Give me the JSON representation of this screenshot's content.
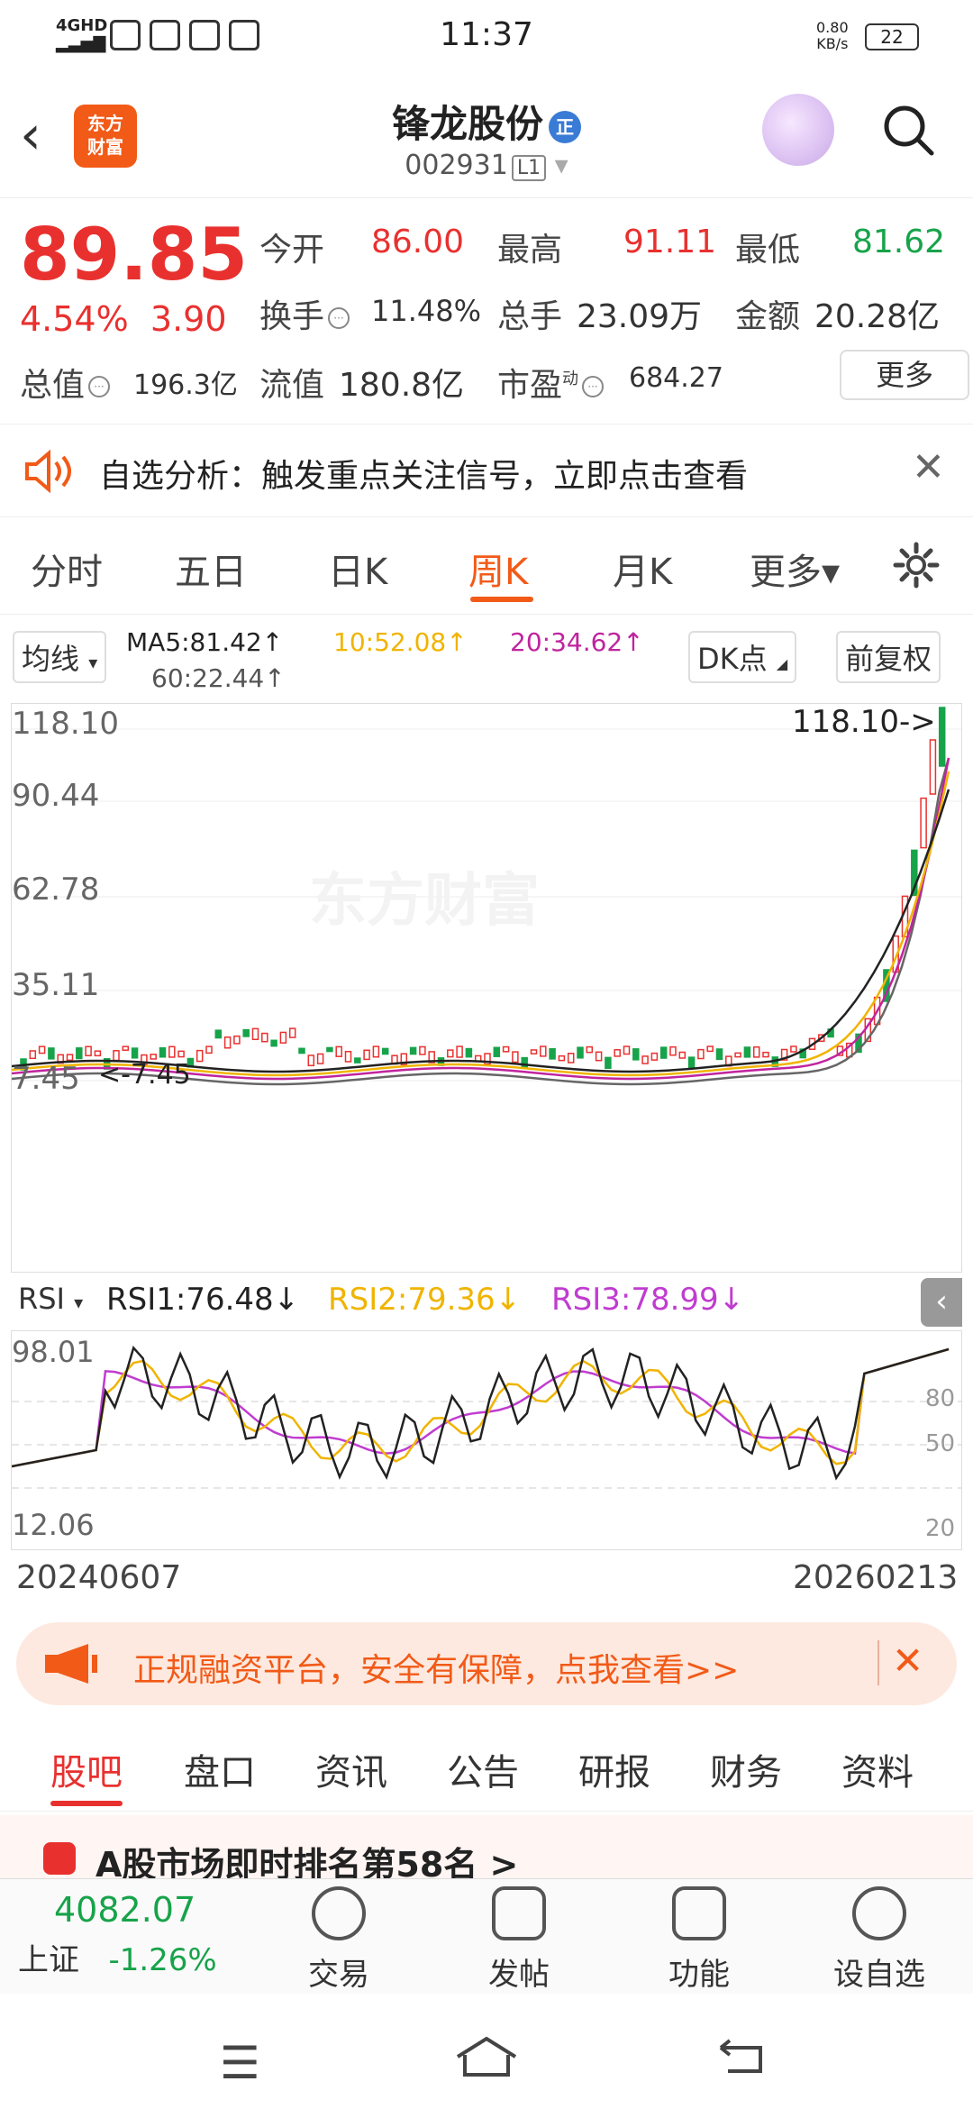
{
  "status": {
    "network": "4GHD",
    "time": "11:37",
    "speed": "0.80",
    "speed_unit": "KB/s",
    "battery": "22"
  },
  "header": {
    "logo": "东方财富",
    "name": "锋龙股份",
    "badge": "正",
    "code": "002931",
    "level": "L1"
  },
  "quote": {
    "price": "89.85",
    "pct": "4.54%",
    "change": "3.90",
    "open_label": "今开",
    "open": "86.00",
    "high_label": "最高",
    "high": "91.11",
    "low_label": "最低",
    "low": "81.62",
    "turnover_label": "换手",
    "turnover": "11.48%",
    "volume_label": "总手",
    "volume": "23.09万",
    "amount_label": "金额",
    "amount": "20.28亿",
    "mktcap_label": "总值",
    "mktcap": "196.3亿",
    "float_label": "流值",
    "float": "180.8亿",
    "pe_label": "市盈",
    "pe_sup": "动",
    "pe": "684.27",
    "more": "更多"
  },
  "alert": {
    "text": "自选分析：触发重点关注信号，立即点击查看"
  },
  "tabs": [
    "分时",
    "五日",
    "日K",
    "周K",
    "月K",
    "更多▾"
  ],
  "active_tab": "周K",
  "ma": {
    "select": "均线",
    "ma5": "MA5:81.42↑",
    "ma10": "10:52.08↑",
    "ma20": "20:34.62↑",
    "ma60": "60:22.44↑",
    "dk": "DK点",
    "adj": "前复权"
  },
  "chart_data": {
    "type": "candlestick",
    "y_ticks": [
      "118.10",
      "90.44",
      "62.78",
      "35.11",
      "7.45"
    ],
    "max_label": "118.10->",
    "min_label": "<-7.45",
    "watermark": "东方财富",
    "colors": {
      "up": "#e8312f",
      "down": "#17a34a",
      "ma5": "#222222",
      "ma10": "#f0b400",
      "ma20": "#c0249e",
      "ma60": "#666666"
    }
  },
  "rsi": {
    "select": "RSI",
    "rsi1": "RSI1:76.48↓",
    "rsi2": "RSI2:79.36↓",
    "rsi3": "RSI3:78.99↓",
    "ticks": [
      "98.01",
      "12.06"
    ],
    "right_ticks": [
      "80",
      "50",
      "20"
    ]
  },
  "dates": {
    "start": "20240607",
    "end": "20260213"
  },
  "banner": {
    "text": "正规融资平台，安全有保障，点我查看>>"
  },
  "subtabs": [
    "股吧",
    "盘口",
    "资讯",
    "公告",
    "研报",
    "财务",
    "资料"
  ],
  "news": "A股市场即时排名第58名 >",
  "index": {
    "value": "4082.07",
    "name": "上证",
    "pct": "-1.26%"
  },
  "bottom": [
    "交易",
    "发帖",
    "功能",
    "设自选"
  ]
}
